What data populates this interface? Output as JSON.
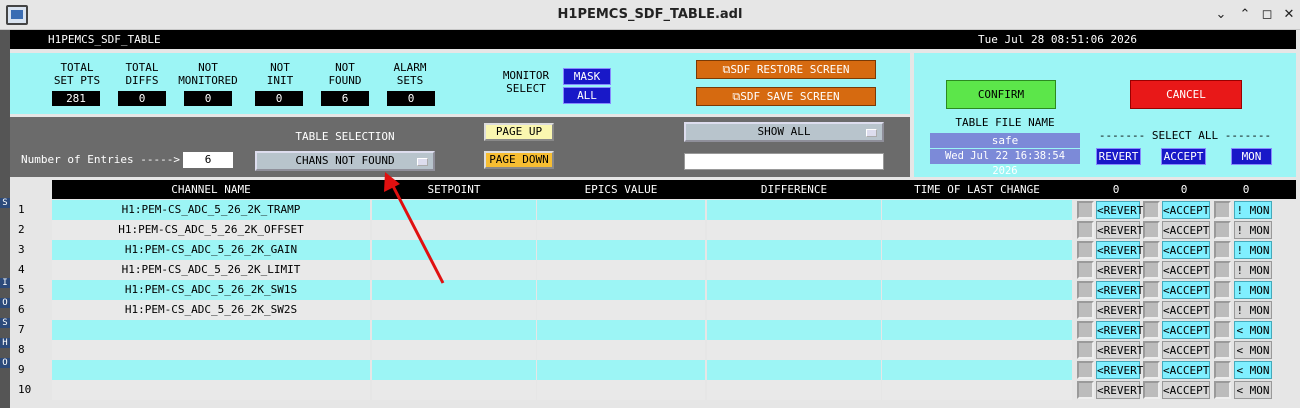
{
  "window": {
    "title": "H1PEMCS_SDF_TABLE.adl",
    "minimize": "⌄",
    "maximize": "⌃",
    "restore": "◻",
    "close": "✕"
  },
  "header": {
    "screen_name": "H1PEMCS_SDF_TABLE",
    "datetime": "Tue Jul 28 08:51:06 2026"
  },
  "left_strip": [
    "S",
    "I",
    "O",
    "S",
    "H",
    "O"
  ],
  "summary": {
    "items": [
      {
        "label1": "TOTAL",
        "label2": "SET PTS",
        "value": "281"
      },
      {
        "label1": "TOTAL",
        "label2": "DIFFS",
        "value": "0"
      },
      {
        "label1": "NOT",
        "label2": "MONITORED",
        "value": "0"
      },
      {
        "label1": "NOT",
        "label2": "INIT",
        "value": "0"
      },
      {
        "label1": "NOT",
        "label2": "FOUND",
        "value": "6"
      },
      {
        "label1": "ALARM",
        "label2": "SETS",
        "value": "0"
      }
    ],
    "monitor_select_l1": "MONITOR",
    "monitor_select_l2": "SELECT",
    "mask_label": "MASK",
    "all_label": "ALL",
    "restore_label": "⧉SDF RESTORE SCREEN",
    "save_label": "⧉SDF SAVE SCREEN"
  },
  "right_panel": {
    "confirm": "CONFIRM",
    "cancel": "CANCEL",
    "file_name_label": "TABLE FILE NAME",
    "file_name": "safe",
    "file_date": "Wed Jul 22 16:38:54 2026",
    "select_all": "------- SELECT ALL --------",
    "revert": "REVERT",
    "accept": "ACCEPT",
    "mon": "MON"
  },
  "controls": {
    "entries_label": "Number of Entries ----->",
    "entries_value": "6",
    "table_selection_label": "TABLE SELECTION",
    "table_selection_value": "CHANS NOT FOUND",
    "page_up": "PAGE UP",
    "page_down": "PAGE DOWN",
    "show_all": "SHOW ALL",
    "filter_value": ""
  },
  "table": {
    "headers": {
      "channel": "CHANNEL NAME",
      "setpoint": "SETPOINT",
      "epics": "EPICS VALUE",
      "difference": "DIFFERENCE",
      "time": "TIME OF LAST CHANGE",
      "count1": "0",
      "count2": "0",
      "count3": "0"
    },
    "revert_btn": "<REVERT",
    "accept_btn": "<ACCEPT",
    "rows": [
      {
        "num": "1",
        "channel": "H1:PEM-CS_ADC_5_26_2K_TRAMP",
        "mon": "! MON"
      },
      {
        "num": "2",
        "channel": "H1:PEM-CS_ADC_5_26_2K_OFFSET",
        "mon": "! MON"
      },
      {
        "num": "3",
        "channel": "H1:PEM-CS_ADC_5_26_2K_GAIN",
        "mon": "! MON"
      },
      {
        "num": "4",
        "channel": "H1:PEM-CS_ADC_5_26_2K_LIMIT",
        "mon": "! MON"
      },
      {
        "num": "5",
        "channel": "H1:PEM-CS_ADC_5_26_2K_SW1S",
        "mon": "! MON"
      },
      {
        "num": "6",
        "channel": "H1:PEM-CS_ADC_5_26_2K_SW2S",
        "mon": "! MON"
      },
      {
        "num": "7",
        "channel": "",
        "mon": "< MON"
      },
      {
        "num": "8",
        "channel": "",
        "mon": "< MON"
      },
      {
        "num": "9",
        "channel": "",
        "mon": "< MON"
      },
      {
        "num": "10",
        "channel": "",
        "mon": "< MON"
      }
    ]
  },
  "colors": {
    "cyan": "#9cf5f5",
    "row_alt": "#e9e9e9",
    "annotation_arrow": "#e01010"
  }
}
